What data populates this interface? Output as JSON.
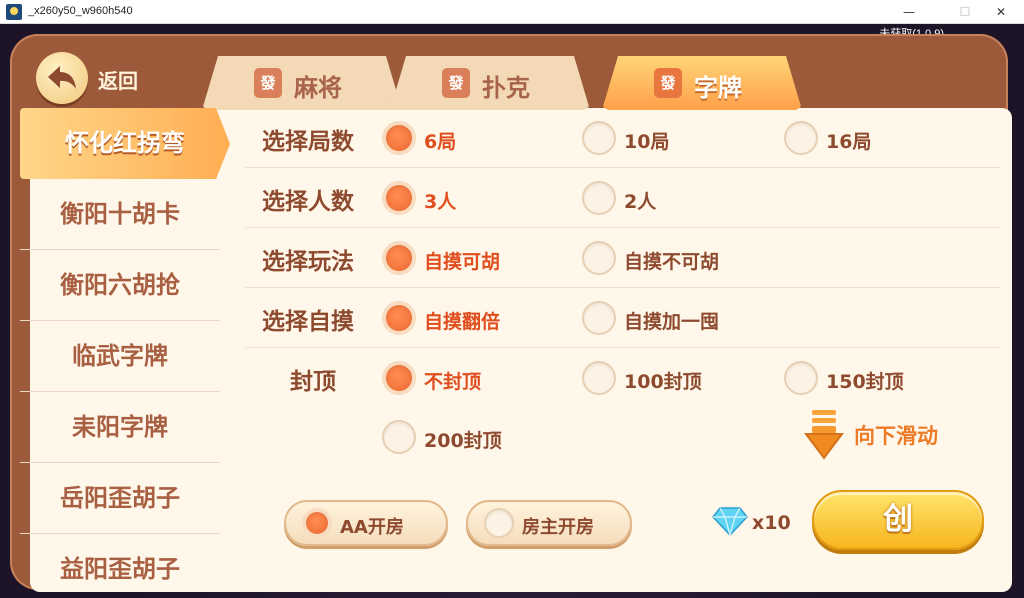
{
  "window": {
    "title": "_x260y50_w960h540",
    "min": "—",
    "max": "☐",
    "close": "✕"
  },
  "version": "未获取(1.0.9)",
  "back_label": "返回",
  "tabs": [
    {
      "chip": "發",
      "label": "麻将"
    },
    {
      "chip": "發",
      "label": "扑克"
    },
    {
      "chip": "發",
      "label": "字牌"
    }
  ],
  "active_tab": 2,
  "sidebar": [
    "怀化红拐弯",
    "衡阳十胡卡",
    "衡阳六胡抢",
    "临武字牌",
    "耒阳字牌",
    "岳阳歪胡子",
    "益阳歪胡子"
  ],
  "rows": [
    {
      "label": "选择局数",
      "options": [
        "6局",
        "10局",
        "16局"
      ],
      "selected": 0
    },
    {
      "label": "选择人数",
      "options": [
        "3人",
        "2人"
      ],
      "selected": 0
    },
    {
      "label": "选择玩法",
      "options": [
        "自摸可胡",
        "自摸不可胡"
      ],
      "selected": 0
    },
    {
      "label": "选择自摸",
      "options": [
        "自摸翻倍",
        "自摸加一囤"
      ],
      "selected": 0
    },
    {
      "label": "封顶",
      "options": [
        "不封顶",
        "100封顶",
        "150封顶",
        "200封顶"
      ],
      "selected": 0
    }
  ],
  "scroll_hint": "向下滑动",
  "pay_modes": [
    {
      "label": "AA开房",
      "selected": true
    },
    {
      "label": "房主开房",
      "selected": false
    }
  ],
  "cost": "x10",
  "create_label": "创",
  "colors": {
    "accent": "#ec6a2f",
    "panel": "#9c5a3a",
    "content_bg": "#fff8ea",
    "text": "#8e4a2f",
    "create": "#f7b51e"
  }
}
